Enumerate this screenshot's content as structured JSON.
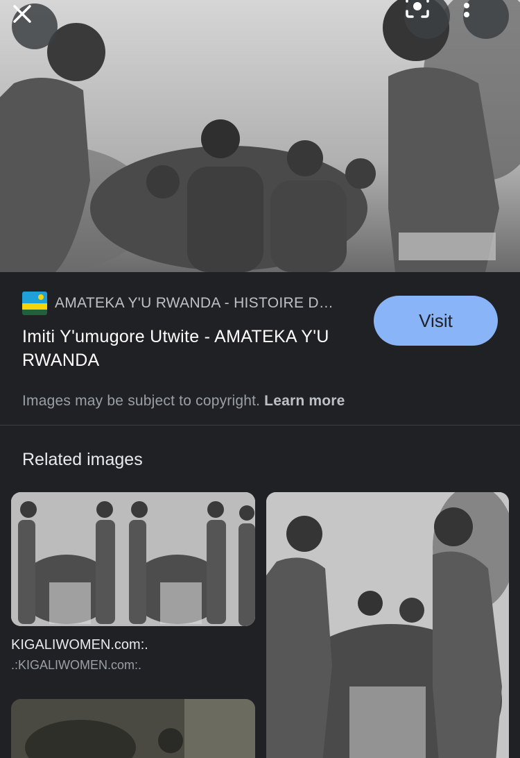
{
  "top_controls": {
    "close_icon": "close-icon",
    "lens_icon": "lens-icon",
    "more_icon": "more-vertical-icon"
  },
  "source": {
    "favicon": "rwanda-flag",
    "site_name": "AMATEKA Y'U RWANDA - HISTOIRE D…"
  },
  "result": {
    "title": "Imiti Y'umugore Utwite - AMATEKA Y'U RWANDA",
    "visit_label": "Visit"
  },
  "copyright": {
    "notice": "Images may be subject to copyright.",
    "learn_more": "Learn more"
  },
  "related": {
    "heading": "Related images",
    "items": [
      {
        "title": "KIGALIWOMEN.com:.",
        "source": ".:KIGALIWOMEN.com:."
      }
    ]
  },
  "colors": {
    "background": "#202124",
    "accent_button": "#8ab4f8",
    "text_primary": "#ffffff",
    "text_secondary": "#9aa0a6"
  }
}
